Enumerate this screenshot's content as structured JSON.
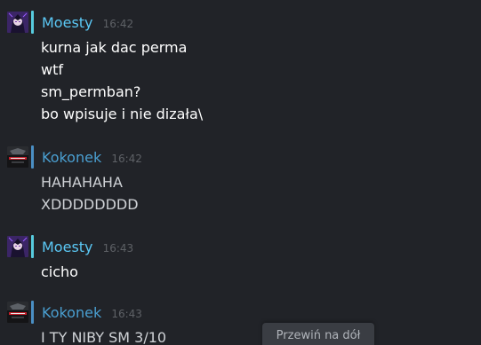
{
  "colors": {
    "background": "#212328",
    "moesty_name": "#5bc8f5",
    "kokonek_name": "#4a9fd1",
    "moesty_text": "#ffffff",
    "kokonek_text": "#cfd2d6",
    "status_online": "#57cbde",
    "status_in_game": "#4a8fc4"
  },
  "messages": [
    {
      "author": "Moesty",
      "time": "16:42",
      "avatar_icon": "anime-character-avatar",
      "lines": [
        "kurna jak dac perma",
        "wtf",
        "sm_permban?",
        "bo wpisuje i nie dizała\\"
      ]
    },
    {
      "author": "Kokonek",
      "time": "16:42",
      "avatar_icon": "game-logo-avatar",
      "lines": [
        "HAHAHAHA",
        "XDDDDDDDD"
      ]
    },
    {
      "author": "Moesty",
      "time": "16:43",
      "avatar_icon": "anime-character-avatar",
      "lines": [
        "cicho"
      ]
    },
    {
      "author": "Kokonek",
      "time": "16:43",
      "avatar_icon": "game-logo-avatar",
      "lines": [
        "I TY NIBY SM 3/10"
      ]
    }
  ],
  "scroll_button": {
    "label": "Przewiń na dół"
  }
}
